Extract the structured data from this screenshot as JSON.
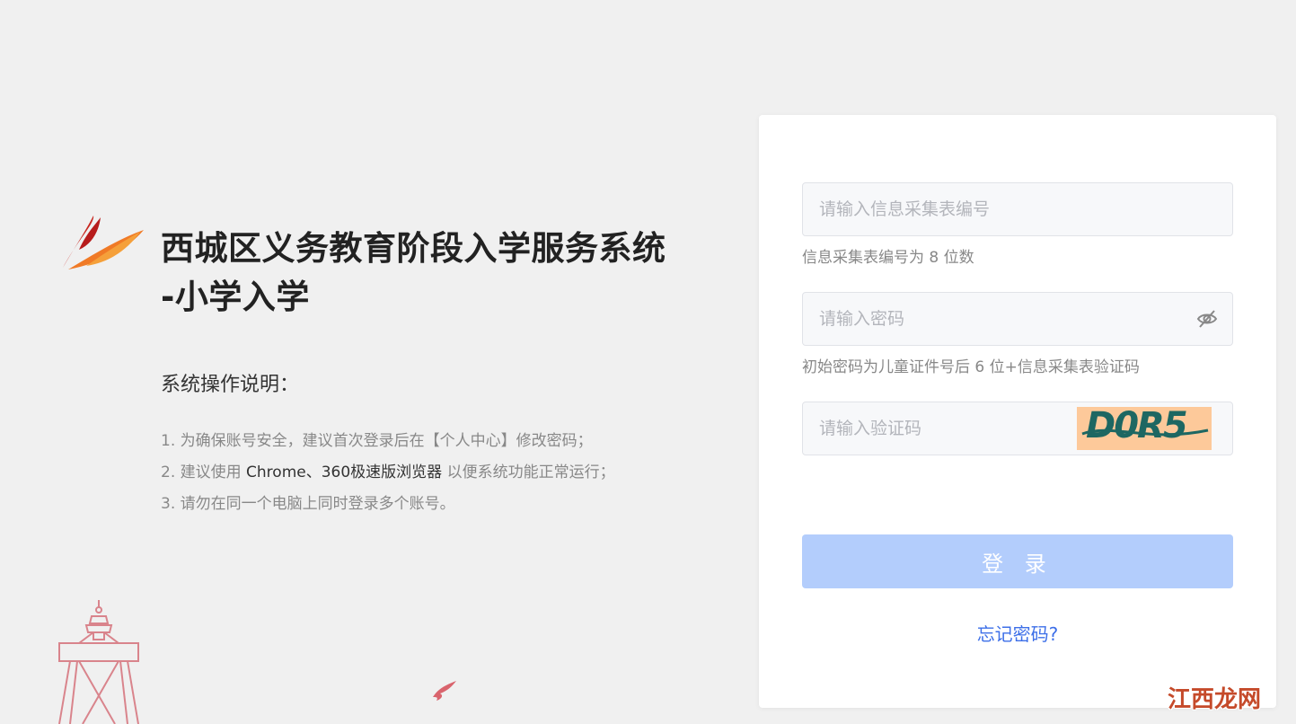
{
  "app": {
    "title_line1": "西城区义务教育阶段入学服务系统",
    "title_line2": "-小学入学"
  },
  "instructions": {
    "heading": "系统操作说明：",
    "items": {
      "item1": "1. 为确保账号安全，建议首次登录后在【个人中心】修改密码；",
      "item2_prefix": "2. 建议使用 ",
      "item2_highlight": "Chrome、360极速版浏览器",
      "item2_suffix": " 以便系统功能正常运行；",
      "item3": "3. 请勿在同一个电脑上同时登录多个账号。"
    }
  },
  "login": {
    "form_no": {
      "placeholder": "请输入信息采集表编号",
      "value": "",
      "hint": "信息采集表编号为 8 位数"
    },
    "password": {
      "placeholder": "请输入密码",
      "value": "",
      "hint": "初始密码为儿童证件号后 6 位+信息采集表验证码",
      "toggle_icon": "eye-off-icon"
    },
    "captcha": {
      "placeholder": "请输入验证码",
      "value": "",
      "image_text": "D0R5"
    },
    "submit_label": "登 录",
    "forgot_label": "忘记密码?"
  },
  "watermark": "江西龙网",
  "colors": {
    "background": "#f0f0f0",
    "card": "#ffffff",
    "button": "#b3cdfc",
    "link": "#3d6fe8",
    "captcha_bg": "#fdc99a",
    "captcha_fg": "#1d6762"
  }
}
